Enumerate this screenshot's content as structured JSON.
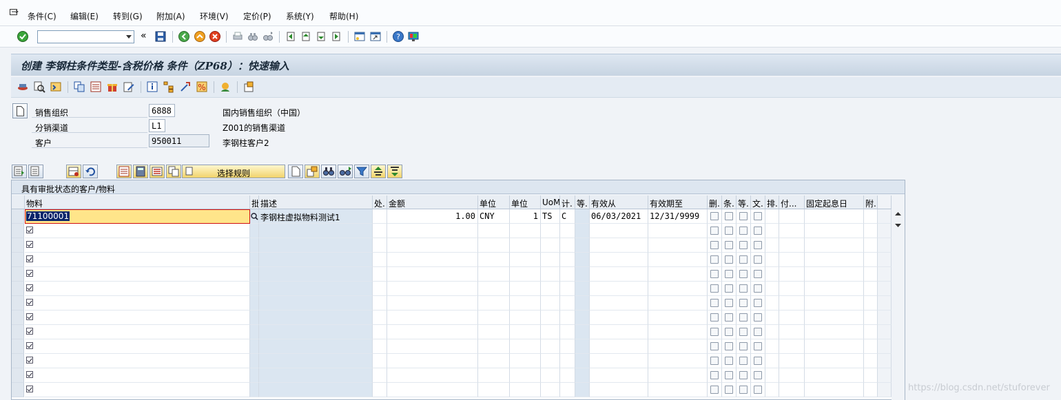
{
  "menu": {
    "items": [
      "条件(C)",
      "编辑(E)",
      "转到(G)",
      "附加(A)",
      "环境(V)",
      "定价(P)",
      "系统(Y)",
      "帮助(H)"
    ]
  },
  "toolbar": {
    "command_value": "",
    "icons": [
      "enter-icon",
      "save-icon",
      "back-icon",
      "exit-icon",
      "cancel-icon",
      "print-icon",
      "find-icon",
      "find-next-icon",
      "first-page-icon",
      "previous-page-icon",
      "next-page-icon",
      "last-page-icon",
      "create-session-icon",
      "shortcut-icon",
      "help-icon",
      "layout-icon"
    ]
  },
  "title": "创建 李钢柱条件类型-含税价格 条件（ZP68）：快速输入",
  "header": {
    "fields": [
      {
        "label": "销售组织",
        "value": "6888",
        "desc": "国内销售组织（中国）"
      },
      {
        "label": "分销渠道",
        "value": "L1",
        "desc": "Z001的销售渠道"
      },
      {
        "label": "客户",
        "value": "950011",
        "desc": "李钢柱客户2"
      }
    ]
  },
  "grid_toolbar": {
    "choose_rule_label": "选择规则"
  },
  "table": {
    "caption": "具有审批状态的客户/物料",
    "columns": [
      "物料",
      "批",
      "描述",
      "处.",
      "金额",
      "单位",
      "单位",
      "UoM",
      "计.",
      "等.",
      "有效从",
      "有效期至",
      "删.",
      "条.",
      "等.",
      "文.",
      "排.",
      "付...",
      "固定起息日",
      "附."
    ],
    "first_row": {
      "material": "71100001",
      "description": "李钢柱虚拟物料测试1",
      "amount": "1.00",
      "currency": "CNY",
      "per": "1",
      "uom": "TS",
      "calc": "C",
      "valid_from": "06/03/2021",
      "valid_to": "12/31/9999"
    }
  },
  "watermark": "https://blog.csdn.net/stuforever"
}
